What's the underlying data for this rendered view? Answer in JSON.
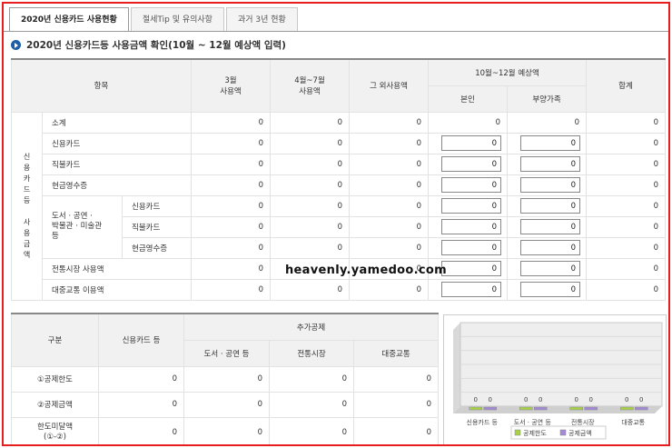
{
  "tabs": [
    "2020년 신용카드 사용현황",
    "절세Tip 및 유의사항",
    "과거 3년 현황"
  ],
  "heading": "2020년 신용카드등 사용금액 확인(10월 ~ 12월 예상액 입력)",
  "table1": {
    "headers": {
      "item": "항목",
      "m3": "3월\n사용액",
      "m4_7": "4월~7월\n사용액",
      "other": "그 외사용액",
      "forecast": "10월~12월 예상액",
      "self": "본인",
      "dependents": "부양가족",
      "total": "합계"
    },
    "side_label": "신\n용\n카\n드\n등\n\n사\n용\n금\n액",
    "culture_label": "도서 · 공연 ·\n박물관 · 미술관\n등",
    "rows": [
      {
        "label": "소계",
        "m3": "0",
        "m4_7": "0",
        "other": "0",
        "self": "0",
        "dep": "0",
        "total": "0"
      },
      {
        "label": "신용카드",
        "m3": "0",
        "m4_7": "0",
        "other": "0",
        "self": "0",
        "dep": "0",
        "total": "0"
      },
      {
        "label": "직불카드",
        "m3": "0",
        "m4_7": "0",
        "other": "0",
        "self": "0",
        "dep": "0",
        "total": "0"
      },
      {
        "label": "현금영수증",
        "m3": "0",
        "m4_7": "0",
        "other": "0",
        "self": "0",
        "dep": "0",
        "total": "0"
      },
      {
        "label": "신용카드",
        "m3": "0",
        "m4_7": "0",
        "other": "0",
        "self": "0",
        "dep": "0",
        "total": "0"
      },
      {
        "label": "직불카드",
        "m3": "0",
        "m4_7": "0",
        "other": "0",
        "self": "0",
        "dep": "0",
        "total": "0"
      },
      {
        "label": "현금영수증",
        "m3": "0",
        "m4_7": "0",
        "other": "0",
        "self": "0",
        "dep": "0",
        "total": "0"
      },
      {
        "label": "전통시장 사용액",
        "m3": "0",
        "other": "0",
        "self": "0",
        "dep": "0",
        "total": "0"
      },
      {
        "label": "대중교통 이용액",
        "m3": "0",
        "m4_7": "0",
        "other": "0",
        "self": "0",
        "dep": "0",
        "total": "0"
      }
    ]
  },
  "watermark": "heavenly.yamedoo.com",
  "table2": {
    "headers": {
      "category": "구분",
      "credit": "신용카드 등",
      "extra": "추가공제",
      "culture": "도서 · 공연 등",
      "market": "전통시장",
      "transit": "대중교통"
    },
    "rows": [
      {
        "label": "①공제한도",
        "credit": "0",
        "culture": "0",
        "market": "0",
        "transit": "0"
      },
      {
        "label": "②공제금액",
        "credit": "0",
        "culture": "0",
        "market": "0",
        "transit": "0"
      },
      {
        "label": "한도미달액\n(①-②)",
        "credit": "0",
        "culture": "0",
        "market": "0",
        "transit": "0"
      }
    ]
  },
  "chart_data": {
    "type": "bar",
    "categories": [
      "신용카드 등",
      "도서 · 공연 등",
      "전통시장",
      "대중교통"
    ],
    "series": [
      {
        "name": "공제한도",
        "values": [
          0,
          0,
          0,
          0
        ],
        "color": "#a8d14a"
      },
      {
        "name": "공제금액",
        "values": [
          0,
          0,
          0,
          0
        ],
        "color": "#a48ad6"
      }
    ],
    "data_labels": [
      "0",
      "0",
      "0",
      "0",
      "0",
      "0",
      "0",
      "0"
    ],
    "legend_position": "bottom",
    "grid": true
  }
}
